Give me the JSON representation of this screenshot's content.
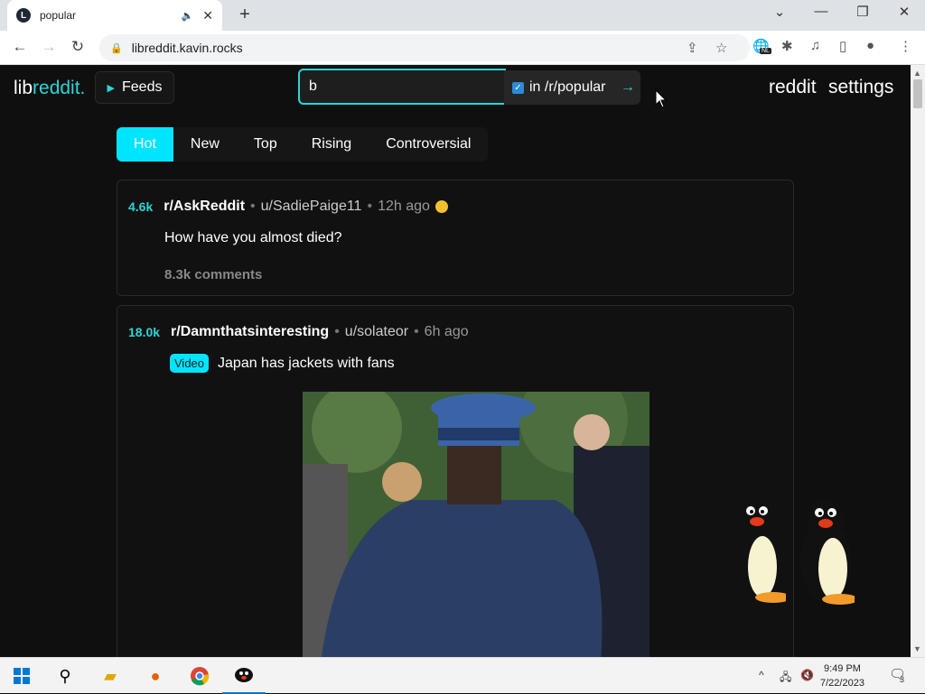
{
  "browser": {
    "tab_title": "popular",
    "url": "libreddit.kavin.rocks",
    "favicon_letter": "L",
    "extension_badge": "NL"
  },
  "site": {
    "brand_part1": "lib",
    "brand_part2": "reddit.",
    "feeds_label": "Feeds",
    "search_value": "b",
    "restrict_label": "in /r/popular",
    "go_symbol": "→",
    "link_reddit": "reddit",
    "link_settings": "settings"
  },
  "sort_tabs": [
    "Hot",
    "New",
    "Top",
    "Rising",
    "Controversial"
  ],
  "posts": [
    {
      "score": "4.6k",
      "subreddit": "r/AskReddit",
      "author": "u/SadiePaige11",
      "time": "12h ago",
      "title": "How have you almost died?",
      "comments": "8.3k comments"
    },
    {
      "score": "18.0k",
      "subreddit": "r/Damnthatsinteresting",
      "author": "u/solateor",
      "time": "6h ago",
      "flair": "Video",
      "title": "Japan has jackets with fans"
    }
  ],
  "taskbar": {
    "time": "9:49 PM",
    "date": "7/22/2023",
    "notifications": "3"
  },
  "colors": {
    "accent": "#2cd5d5",
    "active_tab": "#00e5ff",
    "background": "#0f0f0f"
  }
}
